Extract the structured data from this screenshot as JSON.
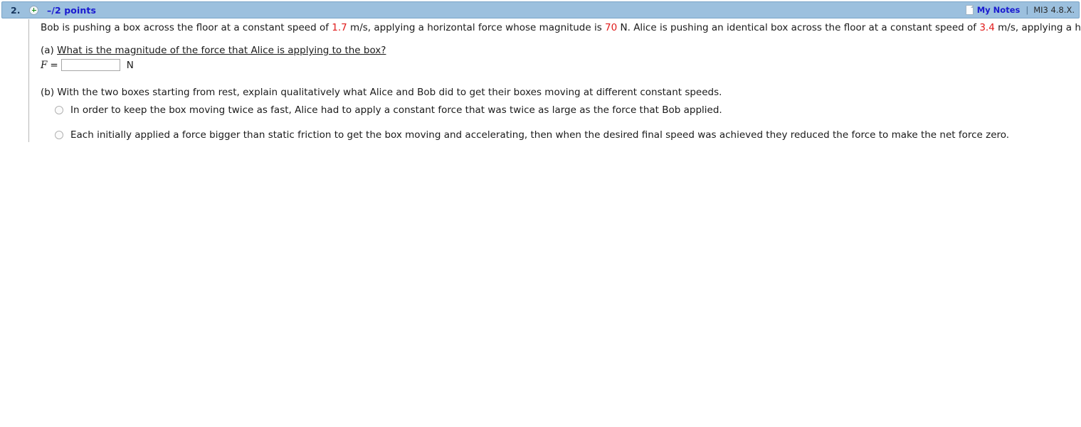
{
  "header": {
    "question_number": "2.",
    "expand_icon": "plus-circle-icon",
    "points": "–/2 points",
    "notes_icon": "note-page-icon",
    "notes_label": "My Notes",
    "separator": "|",
    "version": "MI3 4.8.X.",
    "bar_color": "#9cc0de",
    "points_color": "#1a1ad0"
  },
  "problem": {
    "text_1": "Bob is pushing a box across the floor at a constant speed of ",
    "speed_bob": "1.7",
    "text_2": " m/s, applying a horizontal force whose magnitude is ",
    "force_bob": "70",
    "text_3": " N. Alice is pushing an identical box across the floor at a constant speed of ",
    "speed_alice": "3.4",
    "text_4": " m/s, applying a horizontal force.",
    "value_color": "#e01b1b"
  },
  "part_a": {
    "label": "(a)",
    "question": "What is the magnitude of the force that Alice is applying to the box?",
    "variable": "F",
    "equals": "=",
    "input_value": "",
    "input_placeholder": "",
    "unit": "N"
  },
  "part_b": {
    "label": "(b)",
    "question": "With the two boxes starting from rest, explain qualitatively what Alice and Bob did to get their boxes moving at different constant speeds.",
    "options": [
      {
        "selected": false,
        "text": "In order to keep the box moving twice as fast, Alice had to apply a constant force that was twice as large as the force that Bob applied."
      },
      {
        "selected": false,
        "text": "Each initially applied a force bigger than static friction to get the box moving and accelerating, then when the desired final speed was achieved they reduced the force to make the net force zero."
      }
    ]
  }
}
